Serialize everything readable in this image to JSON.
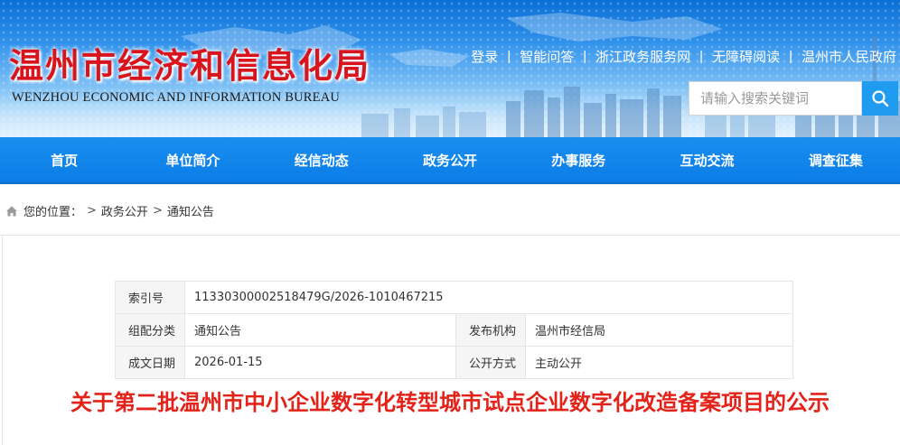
{
  "site": {
    "title": "温州市经济和信息化局",
    "subtitle": "WENZHOU ECONOMIC AND INFORMATION BUREAU"
  },
  "toplinks": [
    "登录",
    "智能问答",
    "浙江政务服务网",
    "无障碍阅读",
    "温州市人民政府"
  ],
  "search": {
    "placeholder": "请输入搜索关键词",
    "icon": "search-icon"
  },
  "nav": [
    "首页",
    "单位简介",
    "经信动态",
    "政务公开",
    "办事服务",
    "互动交流",
    "调查征集"
  ],
  "breadcrumb": {
    "icon": "home-icon",
    "label": "您的位置：",
    "items": [
      "政务公开",
      "通知公告"
    ]
  },
  "info": {
    "index_label": "索引号",
    "index_value": "11330300002518479G/2026-1010467215",
    "category_label": "组配分类",
    "category_value": "通知公告",
    "publisher_label": "发布机构",
    "publisher_value": "温州市经信局",
    "date_label": "成文日期",
    "date_value": "2026-01-15",
    "open_label": "公开方式",
    "open_value": "主动公开"
  },
  "article": {
    "title": "关于第二批温州市中小企业数字化转型城市试点企业数字化改造备案项目的公示"
  },
  "colors": {
    "brand_red": "#d8141d",
    "nav_blue": "#0b7de6",
    "title_red": "#e32219",
    "search_blue": "#1f9bf0"
  }
}
